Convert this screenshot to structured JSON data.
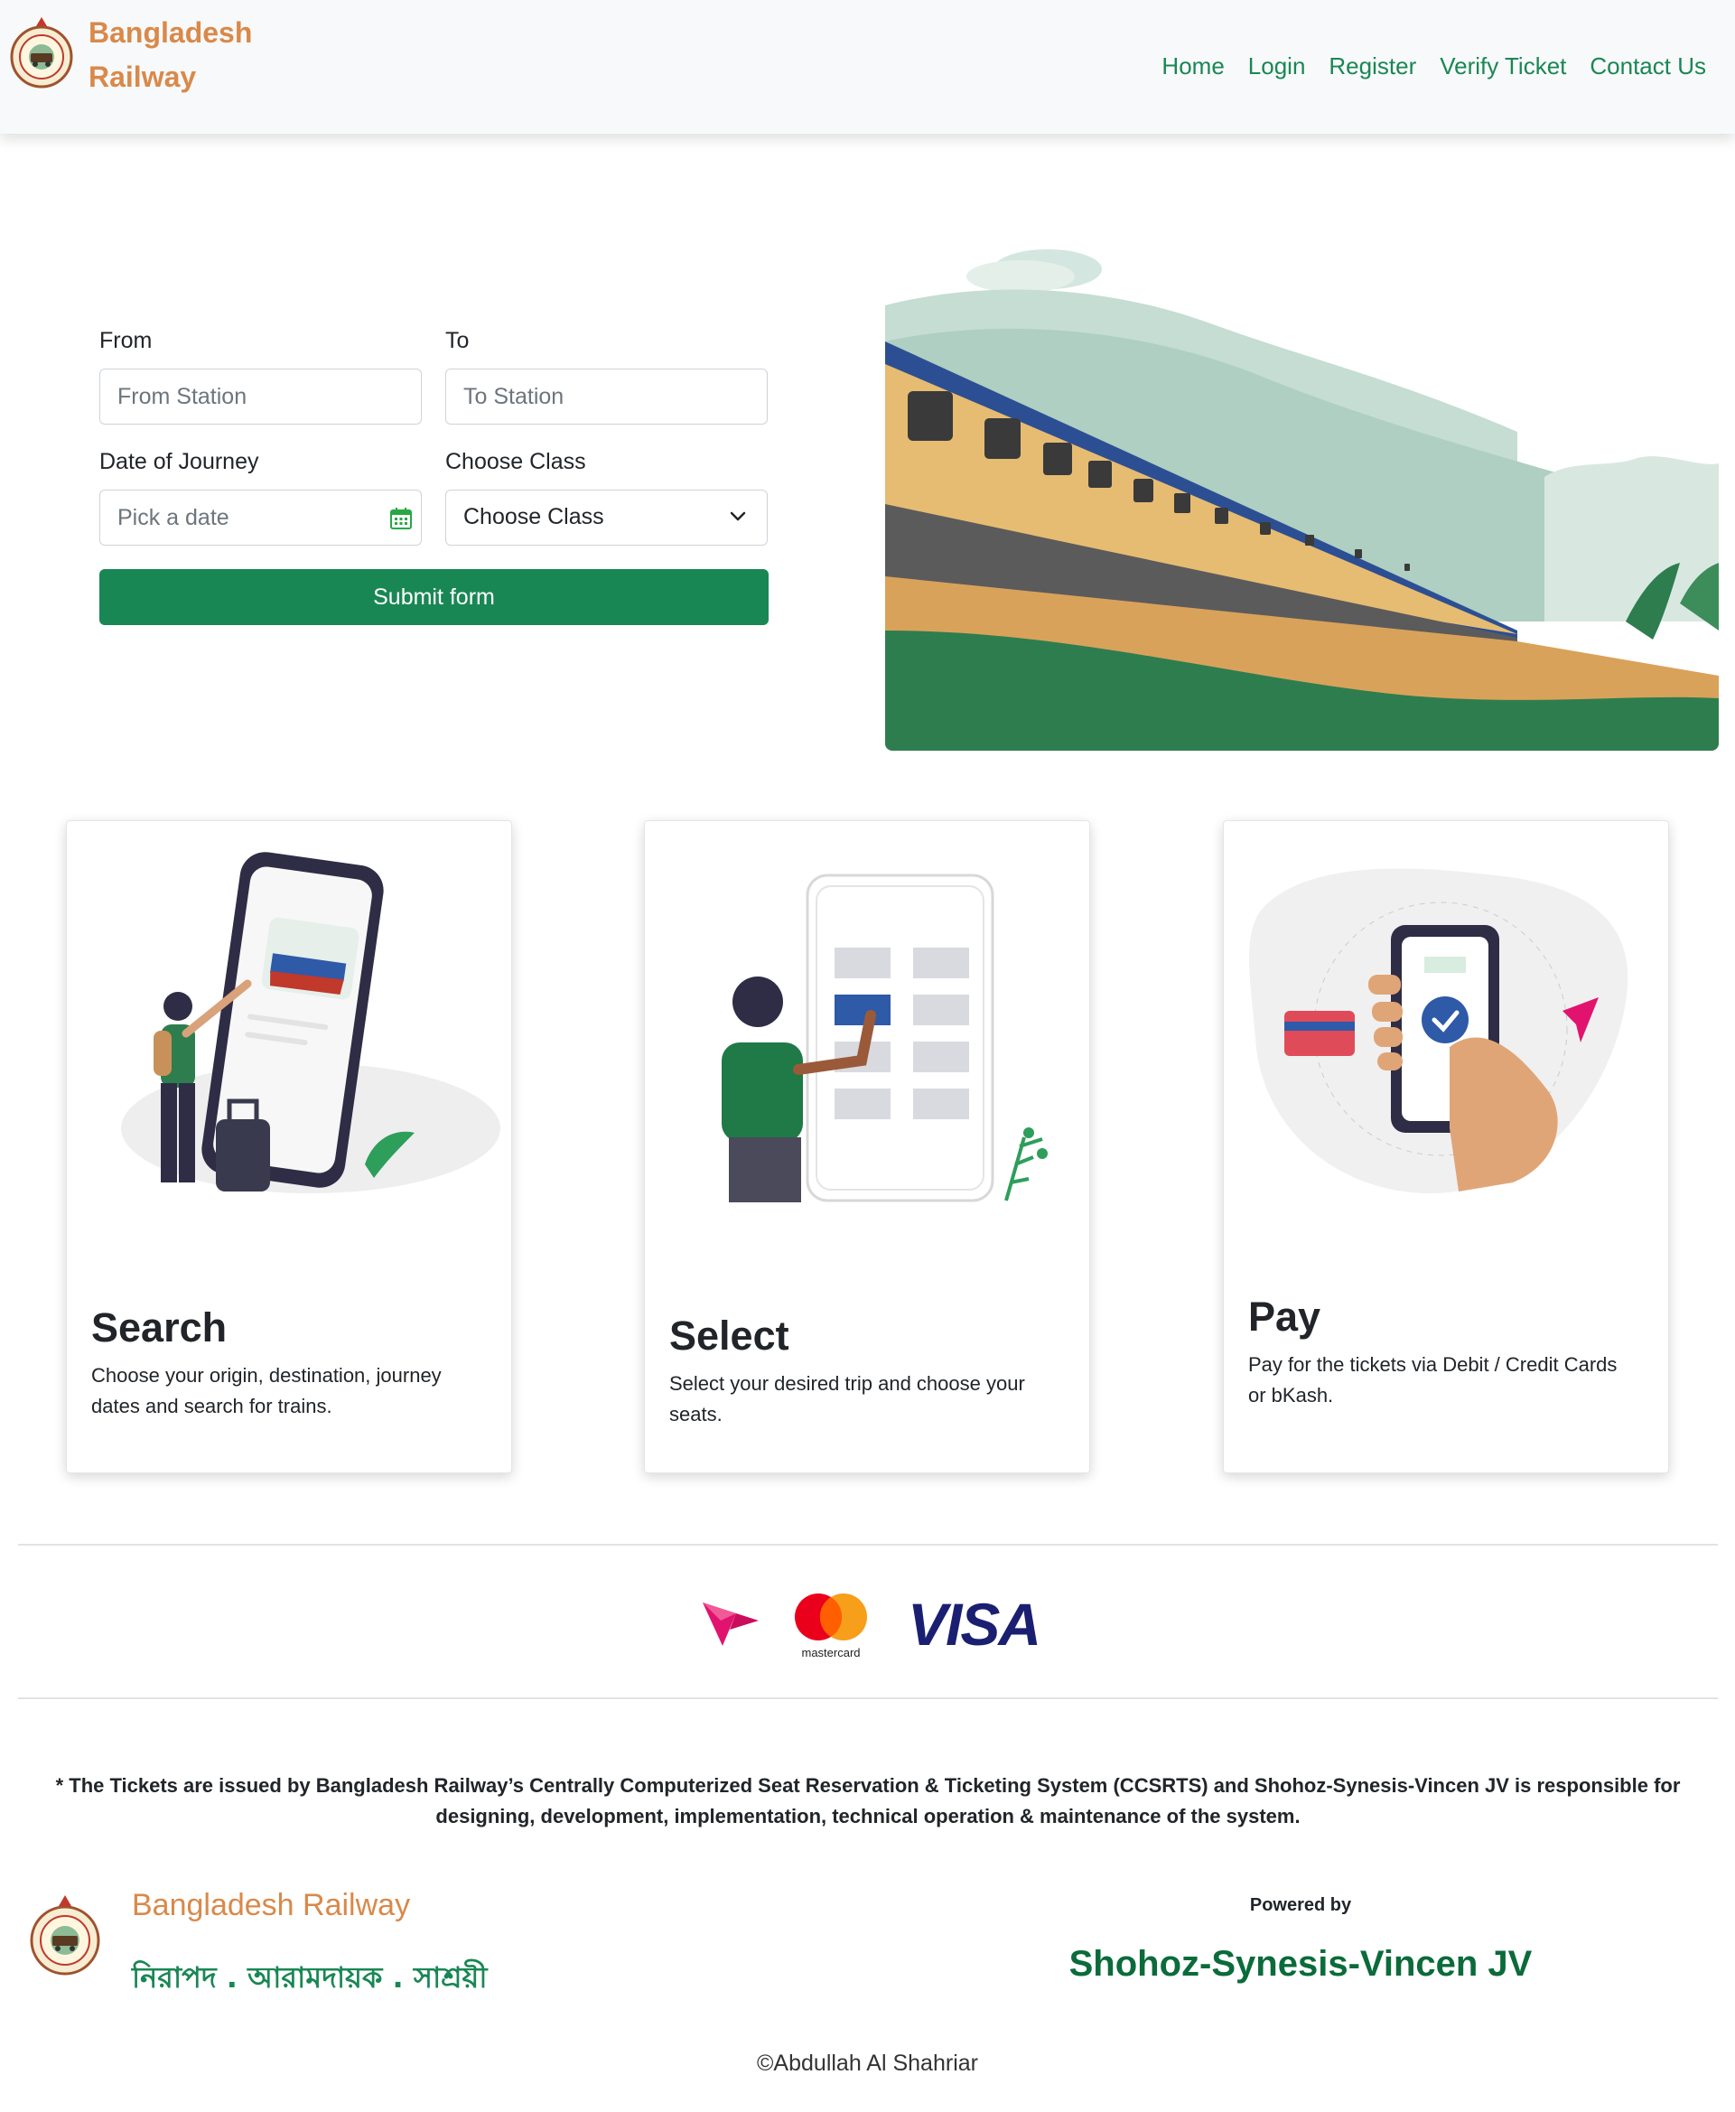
{
  "navbar": {
    "brand_line1": "Bangladesh",
    "brand_line2": "Railway",
    "links": [
      "Home",
      "Login",
      "Register",
      "Verify Ticket",
      "Contact Us"
    ]
  },
  "form": {
    "from_label": "From",
    "from_placeholder": "From Station",
    "to_label": "To",
    "to_placeholder": "To Station",
    "date_label": "Date of Journey",
    "date_placeholder": "Pick a date",
    "class_label": "Choose Class",
    "class_selected": "Choose Class",
    "submit_label": "Submit form"
  },
  "cards": [
    {
      "title": "Search",
      "text": "Choose your origin, destination, journey dates and search for trains."
    },
    {
      "title": "Select",
      "text": "Select your desired trip and choose your seats."
    },
    {
      "title": "Pay",
      "text": "Pay for the tickets via Debit / Credit Cards or bKash."
    }
  ],
  "payment": {
    "mastercard_text": "mastercard",
    "visa_text": "VISA"
  },
  "footer": {
    "disclaimer": "* The Tickets are issued by Bangladesh Railway’s Centrally Computerized Seat Reservation & Ticketing System (CCSRTS) and Shohoz-Synesis-Vincen JV is responsible for designing, development, implementation, technical operation & maintenance of the system.",
    "brand_name": "Bangladesh Railway",
    "motto": "নিরাপদ . আরামদায়ক . সাশ্রয়ী",
    "powered_by": "Powered by",
    "powered_name": "Shohoz-Synesis-Vincen JV",
    "copyright": "©Abdullah Al Shahriar"
  },
  "colors": {
    "brand_orange": "#d9894a",
    "primary_green": "#198754",
    "dark_green": "#0b6b3a"
  },
  "icons": [
    "railway-logo-icon",
    "calendar-icon",
    "chevron-down-icon",
    "bkash-icon"
  ]
}
